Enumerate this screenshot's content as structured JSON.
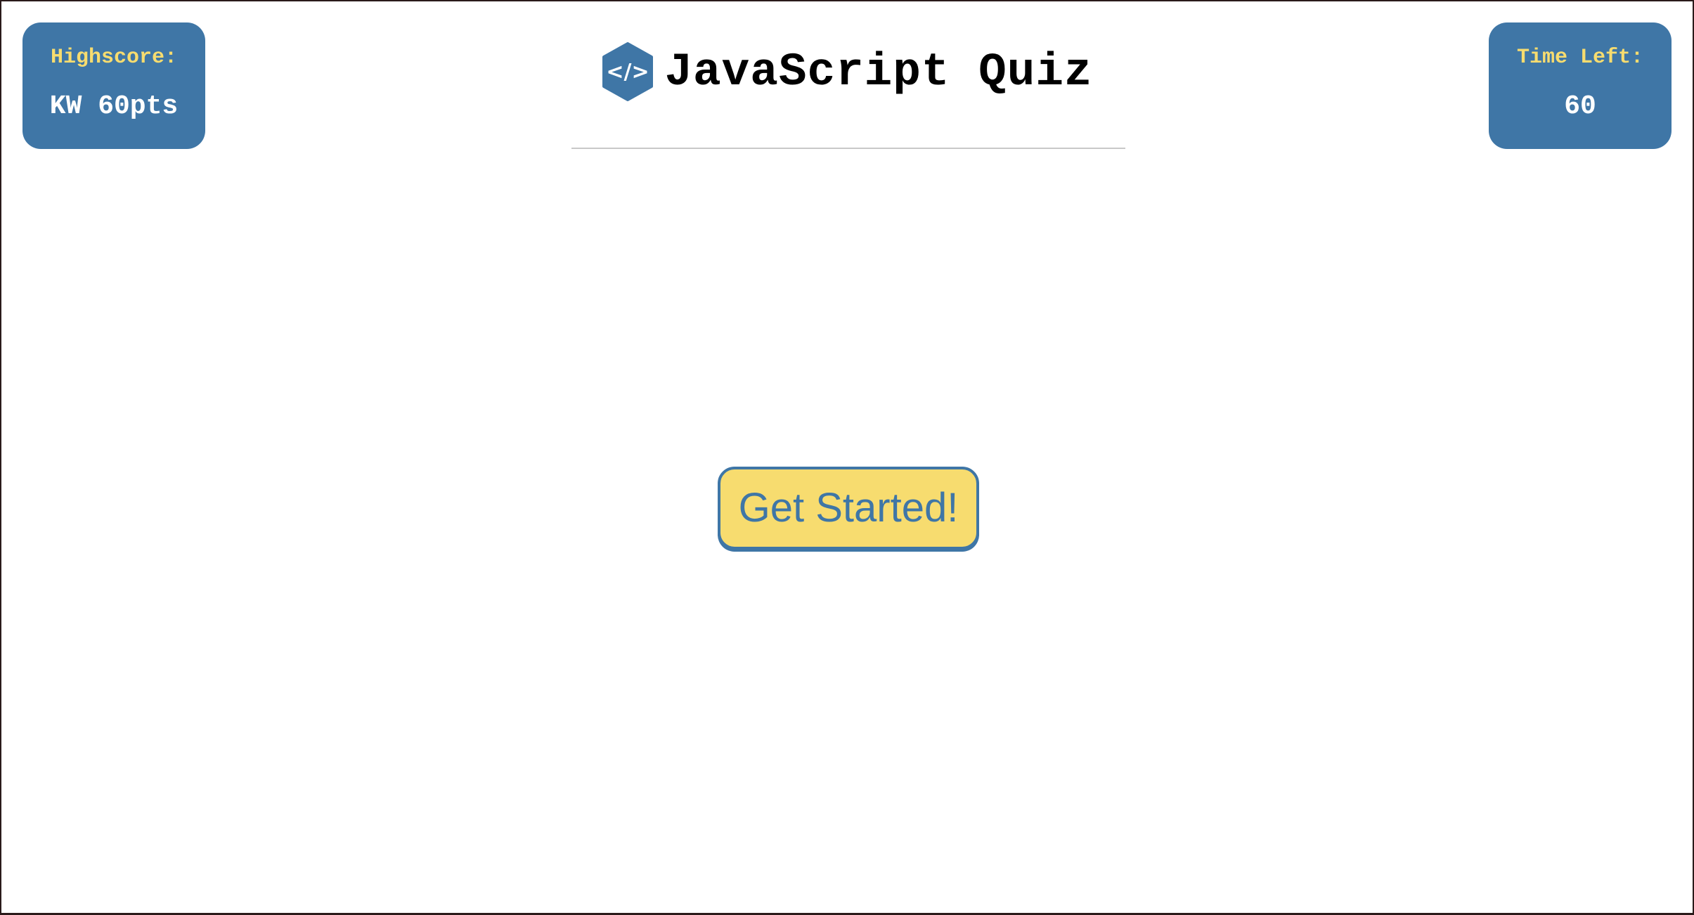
{
  "colors": {
    "accent": "#3f76a6",
    "label": "#f7dc6f",
    "button_bg": "#f7dc6f"
  },
  "highscore": {
    "label": "Highscore:",
    "value": "KW 60pts"
  },
  "timer": {
    "label": "Time Left:",
    "value": "60"
  },
  "header": {
    "logo_icon": "code-hexagon-icon",
    "title": "JavaScript Quiz"
  },
  "start_button": {
    "label": "Get Started!"
  }
}
